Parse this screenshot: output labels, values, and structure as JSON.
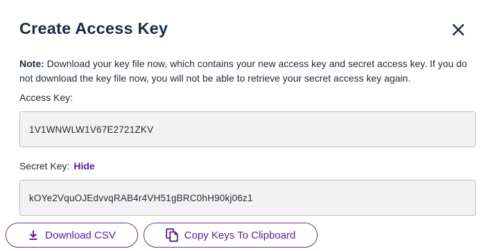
{
  "dialog": {
    "title": "Create Access Key",
    "close_icon": "close-icon",
    "note": {
      "label": "Note:",
      "text": " Download your key file now, which contains your new access key and secret access key. If you do not download the key file now, you will not be able to retrieve your secret access key again."
    },
    "access_key": {
      "label": "Access Key:",
      "value": "1V1WNWLW1V67E2721ZKV"
    },
    "secret_key": {
      "label": "Secret Key:",
      "toggle_label": "Hide",
      "value": "kOYe2VquOJEdvvqRAB4r4VH51gBRC0hH90kj06z1"
    },
    "buttons": {
      "download_csv": {
        "label": "Download CSV",
        "icon": "download-icon"
      },
      "copy_keys": {
        "label": "Copy Keys To Clipboard",
        "icon": "copy-icon"
      }
    }
  },
  "colors": {
    "title": "#1b2a41",
    "accent": "#5a1a8c",
    "field_bg": "#f2f2f2",
    "field_border": "#bdbdbd"
  }
}
